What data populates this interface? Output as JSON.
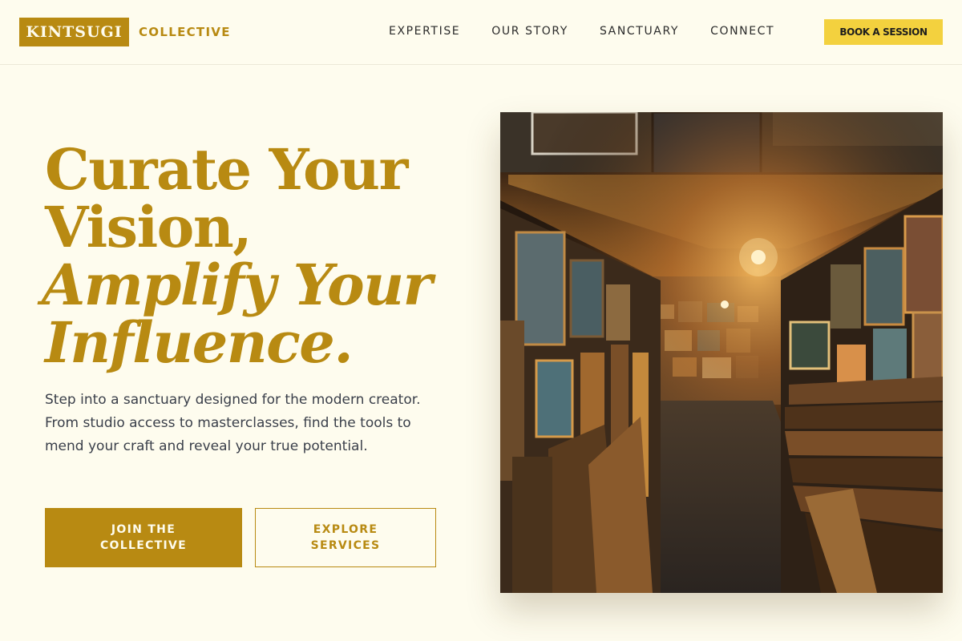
{
  "brand": {
    "mark": "KINTSUGI",
    "word": "COLLECTIVE",
    "accent": "#b88a12",
    "highlight": "#f3d13e",
    "background": "#fefcee"
  },
  "nav": {
    "items": [
      {
        "label": "EXPERTISE"
      },
      {
        "label": "OUR STORY"
      },
      {
        "label": "SANCTUARY"
      },
      {
        "label": "CONNECT"
      }
    ],
    "cta_label": "BOOK A SESSION"
  },
  "hero": {
    "headline_line1": "Curate Your",
    "headline_line2": "Vision,",
    "headline_line3": "Amplify Your",
    "headline_line4": "Influence.",
    "lead": "Step into a sanctuary designed for the modern creator. From studio access to masterclasses, find the tools to mend your craft and reveal your true potential.",
    "primary_cta": "JOIN THE COLLECTIVE",
    "secondary_cta": "EXPLORE SERVICES"
  },
  "image": {
    "subject": "art-gallery-corridor-photo"
  }
}
